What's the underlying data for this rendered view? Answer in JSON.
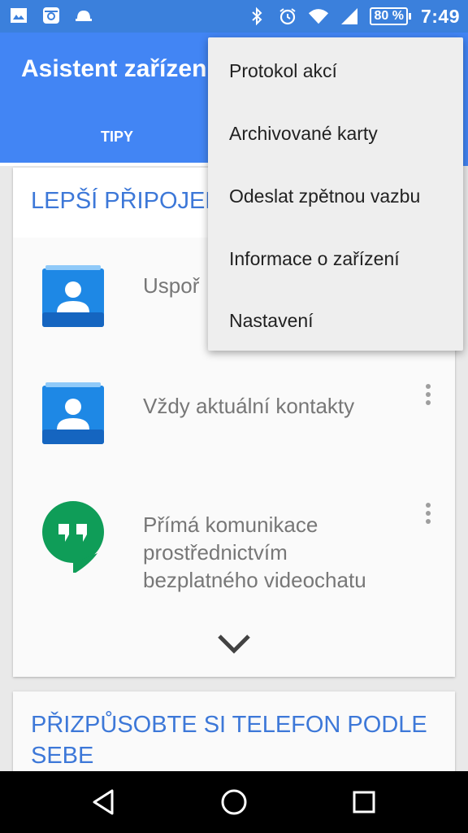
{
  "status_bar": {
    "left_icons": [
      "image-icon",
      "instagram-icon",
      "hat-icon"
    ],
    "right_icons": [
      "bluetooth-icon",
      "alarm-icon",
      "wifi-icon",
      "signal-icon"
    ],
    "battery": "80 %",
    "time": "7:49"
  },
  "app_bar": {
    "title": "Asistent zařízení",
    "tabs": [
      {
        "label": "TIPY",
        "selected": true
      }
    ]
  },
  "main": {
    "card1": {
      "title": "LEPŠÍ PŘIPOJENÍ",
      "items": [
        {
          "icon": "contacts-icon",
          "text": "Uspořádání kontaktních údajů pro..."
        },
        {
          "icon": "contacts-icon",
          "text": "Vždy aktuální kontakty"
        },
        {
          "icon": "hangouts-icon",
          "text": "Přímá komunikace prostřednictvím bezplatného videochatu"
        }
      ]
    },
    "card2": {
      "title": "PŘIZPŮSOBTE SI TELEFON PODLE SEBE"
    }
  },
  "menu": {
    "items": [
      "Protokol akcí",
      "Archivované karty",
      "Odeslat zpětnou vazbu",
      "Informace o zařízení",
      "Nastavení"
    ]
  },
  "nav_bar": {
    "buttons": [
      "back-icon",
      "home-icon",
      "recents-icon"
    ]
  },
  "colors": {
    "app_bar": "#4285f4",
    "status_bar": "#3b80dc",
    "card_title": "#3d78d8",
    "hangouts_green": "#0f9d58",
    "contacts_blue": "#1e88e5"
  }
}
